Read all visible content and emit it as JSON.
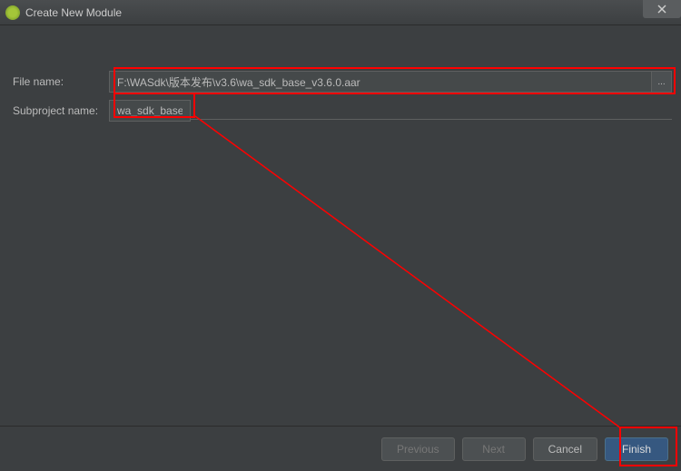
{
  "window": {
    "title": "Create New Module"
  },
  "form": {
    "file_name_label": "File name:",
    "file_name_value": "F:\\WASdk\\版本发布\\v3.6\\wa_sdk_base_v3.6.0.aar",
    "browse_label": "...",
    "subproject_label": "Subproject name:",
    "subproject_value": "wa_sdk_base"
  },
  "buttons": {
    "previous": "Previous",
    "next": "Next",
    "cancel": "Cancel",
    "finish": "Finish"
  }
}
